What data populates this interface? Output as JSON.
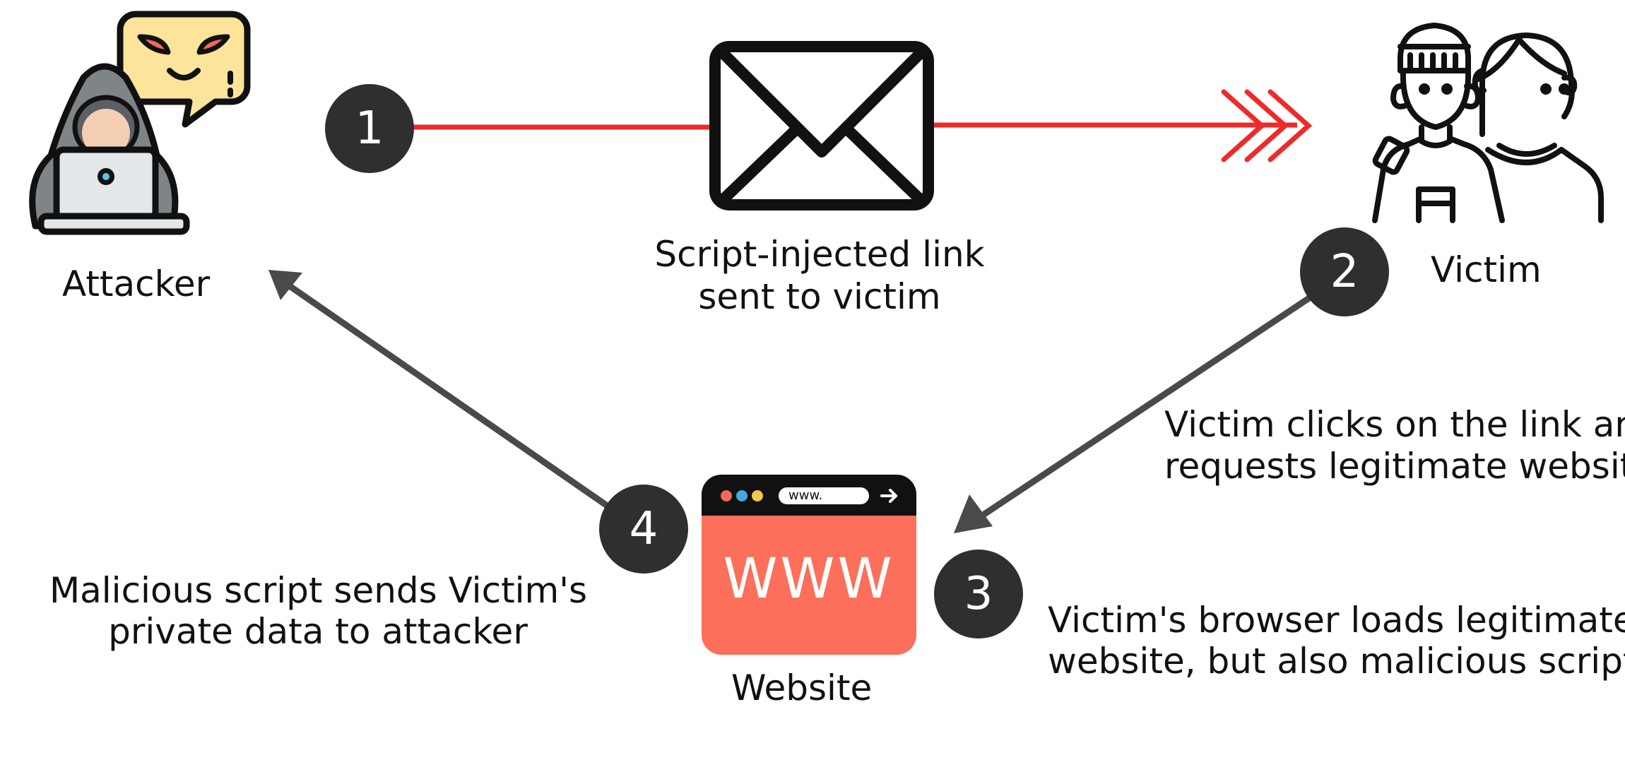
{
  "nodes": {
    "attacker": {
      "label": "Attacker"
    },
    "victim": {
      "label": "Victim"
    },
    "website": {
      "label": "Website",
      "screen_text": "WWW",
      "address_text": "www."
    },
    "email": {
      "label_line1": "Script-injected link",
      "label_line2": "sent to victim"
    }
  },
  "steps": [
    {
      "number": "1"
    },
    {
      "number": "2",
      "text_line1": "Victim clicks on the link and",
      "text_line2": "requests legitimate website"
    },
    {
      "number": "3",
      "text_line1": "Victim's browser loads legitimate",
      "text_line2": "website, but also malicious script"
    },
    {
      "number": "4",
      "text_line1": "Malicious script sends Victim's",
      "text_line2": "private data to attacker"
    }
  ],
  "colors": {
    "arrow_red": "#ee2a2a",
    "arrow_gray": "#4a4a4a",
    "step_circle": "#2f2f2f",
    "website_body": "#fc6f5a",
    "hood": "#7f8487",
    "speech_bubble": "#fde49b",
    "angry_face": "#f06a57"
  },
  "icons": [
    "hacker-icon",
    "speech-bubble-icon",
    "envelope-icon",
    "victims-icon",
    "browser-icon",
    "triple-chevron-icon"
  ]
}
